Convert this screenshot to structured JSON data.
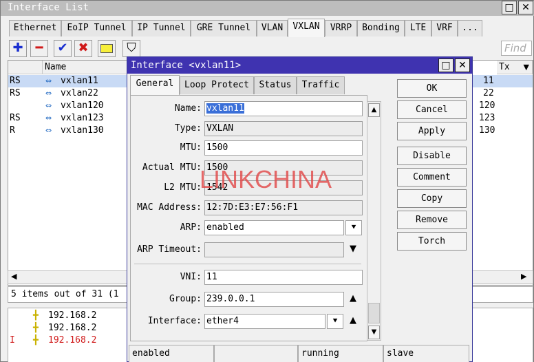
{
  "window": {
    "title": "Interface List",
    "minimize": "□",
    "close": "✕"
  },
  "tabs": [
    "Ethernet",
    "EoIP Tunnel",
    "IP Tunnel",
    "GRE Tunnel",
    "VLAN",
    "VXLAN",
    "VRRP",
    "Bonding",
    "LTE",
    "VRF",
    "..."
  ],
  "active_tab": "VXLAN",
  "toolbar": {
    "add": "✚",
    "remove": "━",
    "enable": "✔",
    "disable": "✖",
    "comment": "▭",
    "filter": "⛉",
    "find_placeholder": "Find"
  },
  "list": {
    "columns": {
      "flags": "",
      "name": "Name",
      "tx": "Tx"
    },
    "rows": [
      {
        "flags": "RS",
        "name": "vxlan11",
        "tx": "11"
      },
      {
        "flags": "RS",
        "name": "vxlan22",
        "tx": "22"
      },
      {
        "flags": "",
        "name": "vxlan120",
        "tx": "120"
      },
      {
        "flags": "RS",
        "name": "vxlan123",
        "tx": "123"
      },
      {
        "flags": "R",
        "name": "vxlan130",
        "tx": "130"
      }
    ],
    "status": "5 items out of 31 (1"
  },
  "lower_list": [
    {
      "flag": "",
      "addr": "192.168.2"
    },
    {
      "flag": "",
      "addr": "192.168.2"
    },
    {
      "flag": "I",
      "addr": "192.168.2"
    }
  ],
  "dialog": {
    "title": "Interface <vxlan11>",
    "tabs": [
      "General",
      "Loop Protect",
      "Status",
      "Traffic"
    ],
    "fields": {
      "name_label": "Name:",
      "name": "vxlan11",
      "type_label": "Type:",
      "type": "VXLAN",
      "mtu_label": "MTU:",
      "mtu": "1500",
      "actual_mtu_label": "Actual MTU:",
      "actual_mtu": "1500",
      "l2mtu_label": "L2 MTU:",
      "l2mtu": "1542",
      "mac_label": "MAC Address:",
      "mac": "12:7D:E3:E7:56:F1",
      "arp_label": "ARP:",
      "arp": "enabled",
      "arp_timeout_label": "ARP Timeout:",
      "arp_timeout": "",
      "vni_label": "VNI:",
      "vni": "11",
      "group_label": "Group:",
      "group": "239.0.0.1",
      "interface_label": "Interface:",
      "interface": "ether4"
    },
    "buttons": {
      "ok": "OK",
      "cancel": "Cancel",
      "apply": "Apply",
      "disable": "Disable",
      "comment": "Comment",
      "copy": "Copy",
      "remove": "Remove",
      "torch": "Torch"
    },
    "statusbar": [
      "enabled",
      "",
      "running",
      "slave"
    ]
  },
  "watermark": "LINKCHINA"
}
